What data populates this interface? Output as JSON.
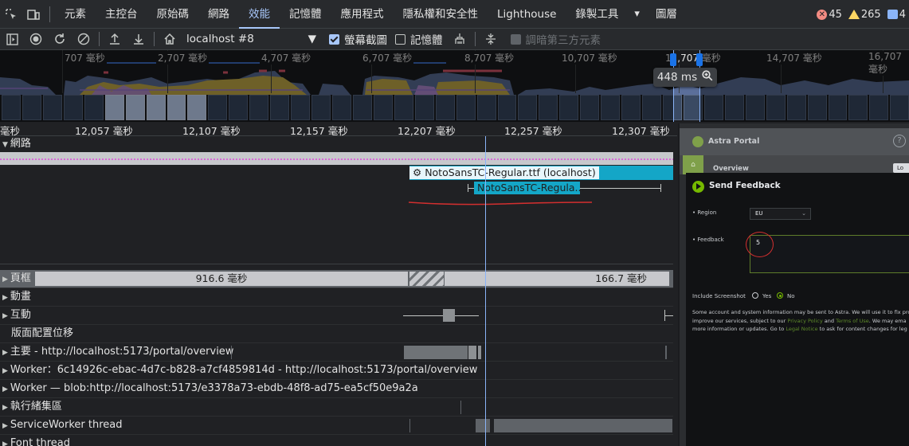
{
  "tabs": [
    "元素",
    "主控台",
    "原始碼",
    "網路",
    "效能",
    "記憶體",
    "應用程式",
    "隱私權和安全性",
    "Lighthouse",
    "錄製工具"
  ],
  "active_tab": "效能",
  "tabs_more": "圖層",
  "badges": {
    "errors": "45",
    "warnings": "265",
    "info": "4"
  },
  "toolbar": {
    "session": "localhost #8",
    "screenshots_label": "螢幕截圖",
    "memory_label": "記憶體",
    "dim_third_party_label": "調暗第三方元素"
  },
  "overview": {
    "ticks": [
      "707 毫秒",
      "2,707 毫秒",
      "4,707 毫秒",
      "6,707 毫秒",
      "8,707 毫秒",
      "10,707 毫秒",
      "12,707 毫秒",
      "14,707 毫秒",
      "16,707 毫秒"
    ],
    "zoom_label": "448 ms"
  },
  "ruler": [
    "毫秒",
    "12,057 毫秒",
    "12,107 毫秒",
    "12,157 毫秒",
    "12,207 毫秒",
    "12,257 毫秒",
    "12,307 毫秒"
  ],
  "network": {
    "header": "網路",
    "request1": "NotoSansTC-Regular.ttf (localhost)",
    "request2": "NotoSansTC-Regula..."
  },
  "tracks": {
    "frames_label": "頁框",
    "frame1": "916.6 毫秒",
    "frame2": "166.7 毫秒",
    "animations": "動畫",
    "interactions": "互動",
    "layout_shifts": "版面配置位移",
    "main": "主要 - http://localhost:5173/portal/overview",
    "worker1": "Worker：6c14926c-ebac-4d7c-b828-a7cf4859814d - http://localhost:5173/portal/overview",
    "worker2": "Worker — blob:http://localhost:5173/e3378a73-ebdb-48f8-ad75-ea5cf50e9a2a",
    "thread_pool": "執行緒集區",
    "service_worker": "ServiceWorker thread",
    "font_thread": "Font thread"
  },
  "screenshot": {
    "app_title": "Astra Portal",
    "nav_label": "Overview",
    "nav_pill": "Lo",
    "dialog_title": "Send Feedback",
    "region_label": "Region",
    "region_value": "EU",
    "feedback_label": "Feedback",
    "feedback_value": "5",
    "include_label": "Include Screenshot",
    "yes": "Yes",
    "no": "No",
    "disclaimer_a": "Some account and system information may be sent to Astra. We will use it to fix pro",
    "disclaimer_b": "improve our services, subject to our",
    "privacy_link": "Privacy Policy",
    "and": "and",
    "terms_link": "Terms of Use",
    "disclaimer_c": ". We may ema",
    "disclaimer_d": "more information or updates. Go to",
    "legal_link": "Legal Notice",
    "disclaimer_e": "to ask for content changes for leg"
  },
  "colors": {
    "accent": "#a8c7fa",
    "network_request": "#14a6c7",
    "annotation": "#d32f2f",
    "brand_green": "#76b900"
  }
}
